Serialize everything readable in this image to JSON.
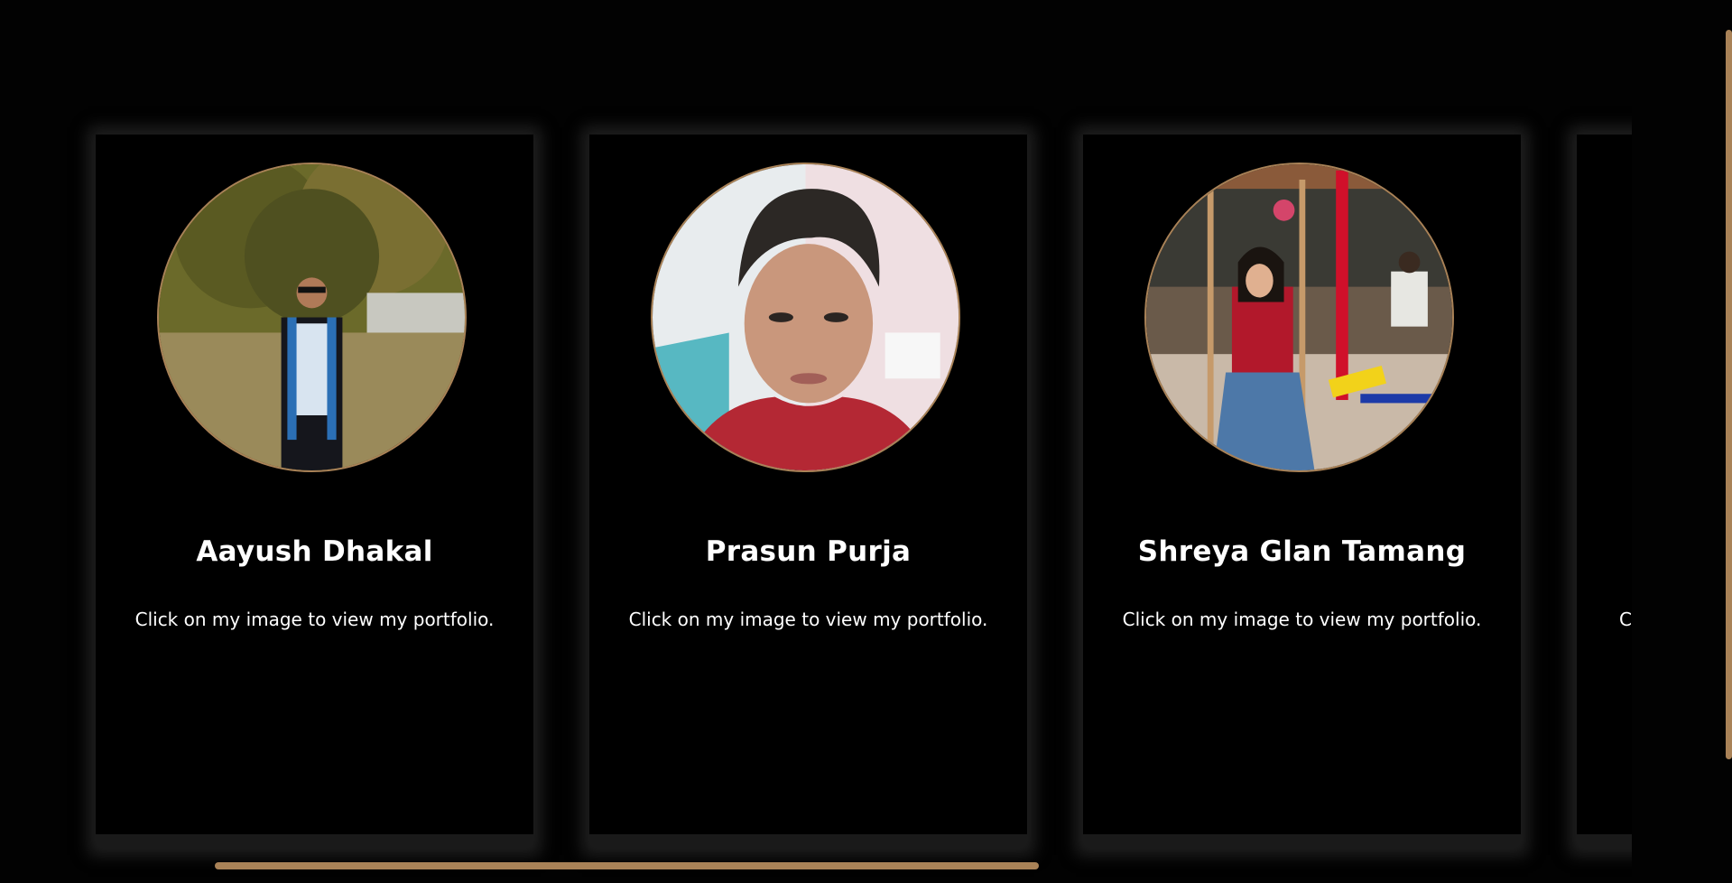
{
  "team": {
    "members": [
      {
        "name": "Aayush Dhakal",
        "caption": "Click on my image to view my portfolio."
      },
      {
        "name": "Prasun Purja",
        "caption": "Click on my image to view my portfolio."
      },
      {
        "name": "Shreya Glan Tamang",
        "caption": "Click on my image to view my portfolio."
      }
    ],
    "partial_caption": "Cl"
  },
  "colors": {
    "background": "#020202",
    "card": "#000000",
    "accent": "#a98257",
    "text": "#ffffff"
  }
}
